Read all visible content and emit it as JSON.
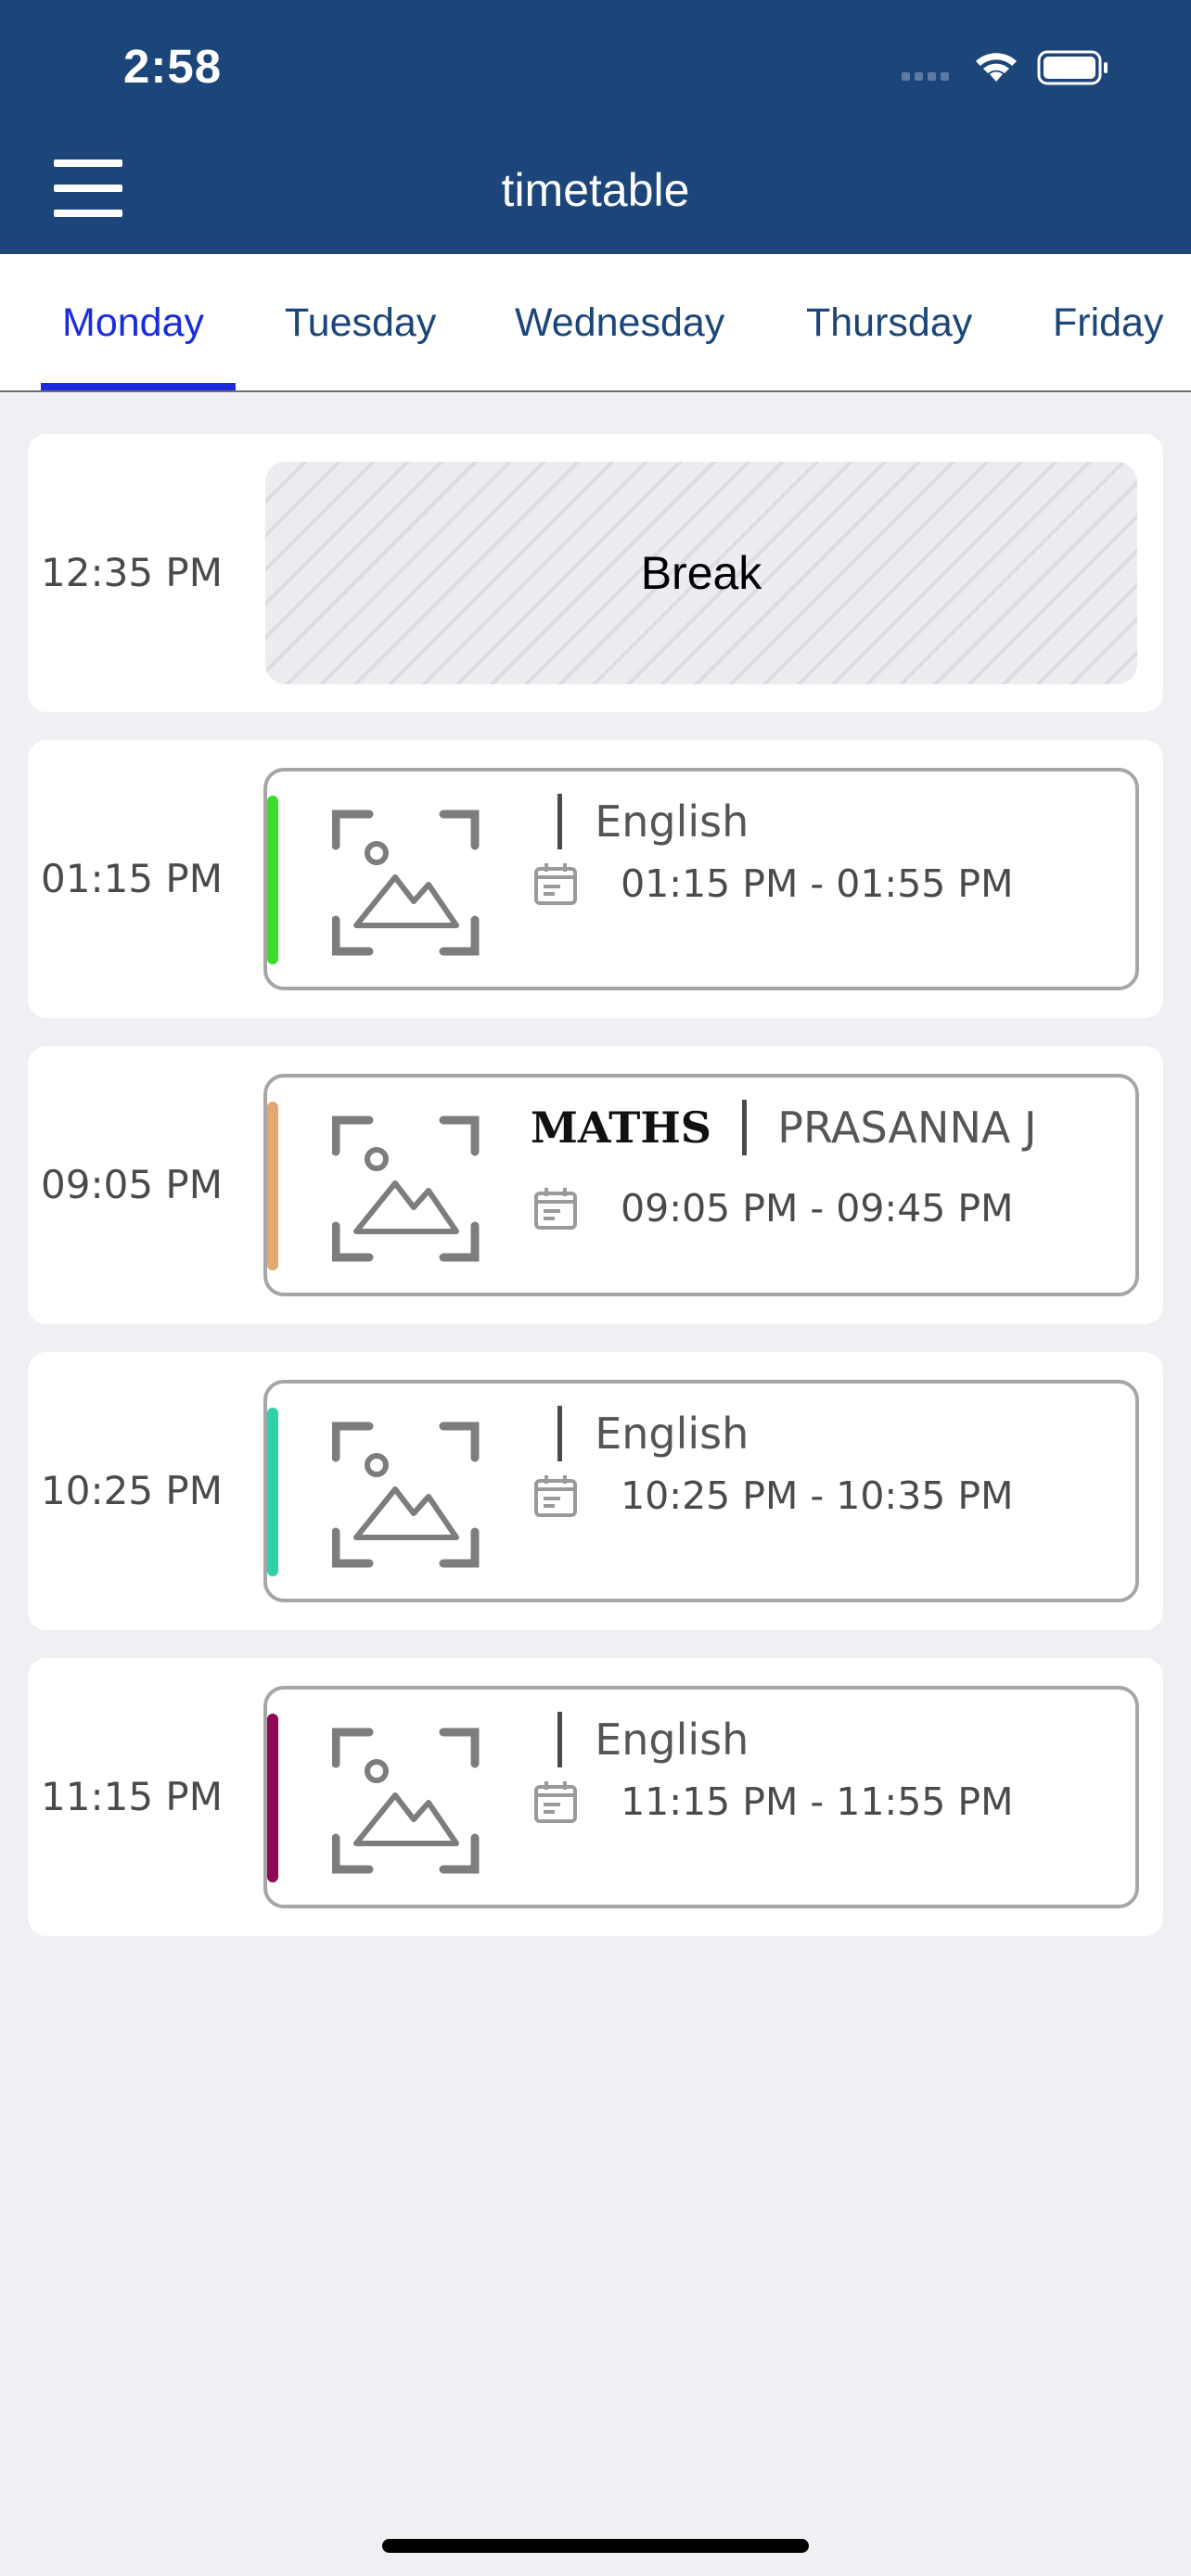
{
  "status_bar": {
    "time": "2:58"
  },
  "header": {
    "title": "timetable",
    "menu_icon": "hamburger-menu-icon"
  },
  "tabs": [
    {
      "label": "Monday",
      "active": true
    },
    {
      "label": "Tuesday",
      "active": false
    },
    {
      "label": "Wednesday",
      "active": false
    },
    {
      "label": "Thursday",
      "active": false
    },
    {
      "label": "Friday",
      "active": false
    }
  ],
  "schedule": [
    {
      "time": "12:35 PM",
      "type": "break",
      "label": "Break"
    },
    {
      "time": "01:15 PM",
      "type": "class",
      "subject": "",
      "teacher": "English",
      "range": "01:15 PM - 01:55 PM",
      "color": "#3ddc28"
    },
    {
      "time": "09:05 PM",
      "type": "class",
      "subject": "MATHS",
      "teacher": "PRASANNA  J",
      "range": "09:05 PM - 09:45 PM",
      "color": "#e2a772"
    },
    {
      "time": "10:25 PM",
      "type": "class",
      "subject": "",
      "teacher": "English",
      "range": "10:25 PM - 10:35 PM",
      "color": "#2fd1a8"
    },
    {
      "time": "11:15 PM",
      "type": "class",
      "subject": "",
      "teacher": "English",
      "range": "11:15 PM - 11:55 PM",
      "color": "#8f0a52"
    }
  ],
  "colors": {
    "header_bg": "#1c467a",
    "tab_active": "#1a2bdc",
    "tab_inactive": "#1c467a"
  }
}
